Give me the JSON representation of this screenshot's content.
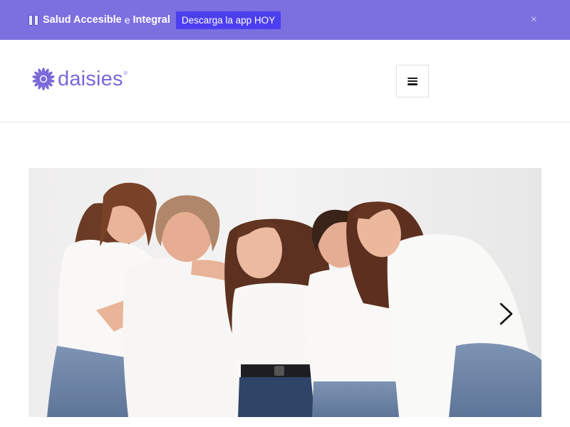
{
  "promo": {
    "title_part1": "Salud Accesible",
    "title_connector": "e",
    "title_part2": "Integral",
    "cta_label": "Descarga la app HOY",
    "close_label": "×",
    "flag_icon": "ribbon-flag-icon"
  },
  "header": {
    "logo_text": "daisies",
    "logo_reg": "®",
    "menu_icon": "hamburger-menu-icon"
  },
  "hero": {
    "image_subject": "five-women-white-tshirts-photo",
    "next_icon": "chevron-right-icon"
  },
  "colors": {
    "promo_bg": "#7c6fe0",
    "cta_bg": "#4b3ff0",
    "brand": "#7b68d9"
  }
}
